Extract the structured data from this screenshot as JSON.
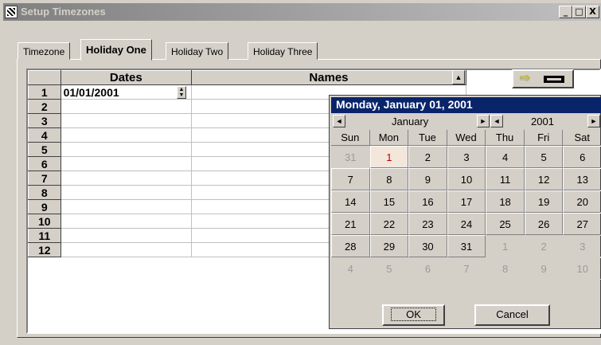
{
  "window": {
    "title": "Setup Timezones",
    "buttons": {
      "minimize": "_",
      "maximize": "□",
      "close": "X"
    }
  },
  "tabs": [
    {
      "label": "Timezone",
      "active": false
    },
    {
      "label": "Holiday One",
      "active": true
    },
    {
      "label": "Holiday Two",
      "active": false
    },
    {
      "label": "Holiday Three",
      "active": false
    }
  ],
  "grid": {
    "columns": {
      "dates": "Dates",
      "names": "Names"
    },
    "rows": [
      {
        "num": "1",
        "date": "01/01/2001",
        "name": ""
      },
      {
        "num": "2",
        "date": "",
        "name": ""
      },
      {
        "num": "3",
        "date": "",
        "name": ""
      },
      {
        "num": "4",
        "date": "",
        "name": ""
      },
      {
        "num": "5",
        "date": "",
        "name": ""
      },
      {
        "num": "6",
        "date": "",
        "name": ""
      },
      {
        "num": "7",
        "date": "",
        "name": ""
      },
      {
        "num": "8",
        "date": "",
        "name": ""
      },
      {
        "num": "9",
        "date": "",
        "name": ""
      },
      {
        "num": "10",
        "date": "",
        "name": ""
      },
      {
        "num": "11",
        "date": "",
        "name": ""
      },
      {
        "num": "12",
        "date": "",
        "name": ""
      }
    ]
  },
  "calendar": {
    "header": "Monday, January 01, 2001",
    "month": "January",
    "year": "2001",
    "daynames": [
      "Sun",
      "Mon",
      "Tue",
      "Wed",
      "Thu",
      "Fri",
      "Sat"
    ],
    "days": [
      {
        "d": "31",
        "o": true
      },
      {
        "d": "1",
        "s": true
      },
      {
        "d": "2"
      },
      {
        "d": "3"
      },
      {
        "d": "4"
      },
      {
        "d": "5"
      },
      {
        "d": "6"
      },
      {
        "d": "7"
      },
      {
        "d": "8"
      },
      {
        "d": "9"
      },
      {
        "d": "10"
      },
      {
        "d": "11"
      },
      {
        "d": "12"
      },
      {
        "d": "13"
      },
      {
        "d": "14"
      },
      {
        "d": "15"
      },
      {
        "d": "16"
      },
      {
        "d": "17"
      },
      {
        "d": "18"
      },
      {
        "d": "19"
      },
      {
        "d": "20"
      },
      {
        "d": "21"
      },
      {
        "d": "22"
      },
      {
        "d": "23"
      },
      {
        "d": "24"
      },
      {
        "d": "25"
      },
      {
        "d": "26"
      },
      {
        "d": "27"
      },
      {
        "d": "28"
      },
      {
        "d": "29"
      },
      {
        "d": "30"
      },
      {
        "d": "31"
      },
      {
        "d": "1",
        "o": true
      },
      {
        "d": "2",
        "o": true
      },
      {
        "d": "3",
        "o": true
      },
      {
        "d": "4",
        "o": true
      },
      {
        "d": "5",
        "o": true
      },
      {
        "d": "6",
        "o": true
      },
      {
        "d": "7",
        "o": true
      },
      {
        "d": "8",
        "o": true
      },
      {
        "d": "9",
        "o": true
      },
      {
        "d": "10",
        "o": true
      }
    ],
    "ok_label": "OK",
    "cancel_label": "Cancel"
  },
  "icons": {
    "prev": "◄",
    "next": "►",
    "scroll_up": "▲",
    "spin": "▲▼",
    "expand_arrow": "⇨"
  },
  "colors": {
    "face": "#d4d0c8",
    "header_blue": "#0a246a",
    "selected_day_bg": "#f3e6da",
    "selected_day_text": "#c00000"
  }
}
